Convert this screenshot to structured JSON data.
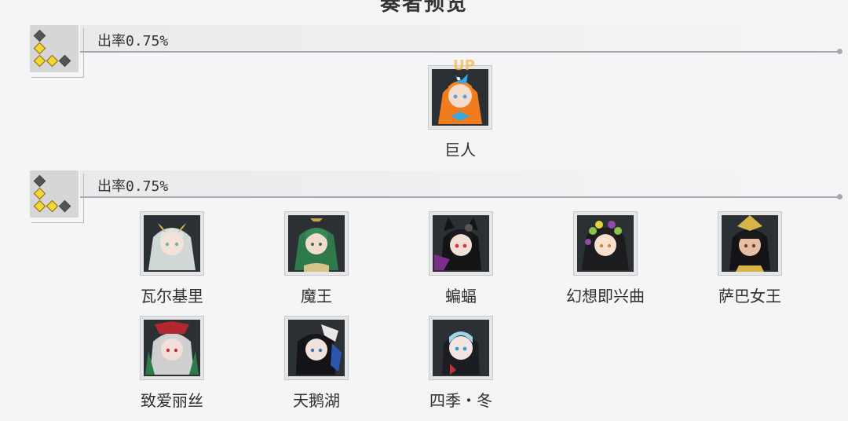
{
  "page": {
    "title": "奏者预览"
  },
  "sections": [
    {
      "rate_label": "出率0.75%",
      "characters": [
        {
          "name": "巨人",
          "badge": "UP"
        }
      ]
    },
    {
      "rate_label": "出率0.75%",
      "characters": [
        {
          "name": "瓦尔基里"
        },
        {
          "name": "魔王"
        },
        {
          "name": "蝙蝠"
        },
        {
          "name": "幻想即兴曲"
        },
        {
          "name": "萨巴女王"
        },
        {
          "name": "致爱丽丝"
        },
        {
          "name": "天鹅湖"
        },
        {
          "name": "四季・冬"
        }
      ]
    }
  ],
  "colors": {
    "background": "#f4f5f6",
    "divider": "#a8a8ad",
    "gold_diamond": "#f1d636",
    "dark_diamond": "#555555"
  },
  "icons": {
    "rarity": "rarity-diamonds-icon",
    "portrait": "character-portrait-icon"
  }
}
